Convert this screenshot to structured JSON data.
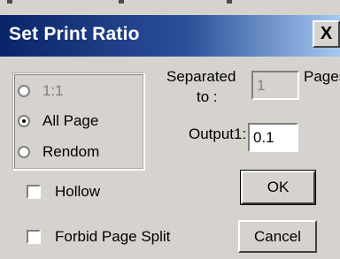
{
  "window": {
    "title": "Set Print Ratio",
    "close_glyph": "X"
  },
  "ratio_group": {
    "options": [
      {
        "label": "1:1",
        "checked": false,
        "enabled": false
      },
      {
        "label": "All Page",
        "checked": true,
        "enabled": true
      },
      {
        "label": "Rendom",
        "checked": false,
        "enabled": true
      }
    ]
  },
  "separated": {
    "label_line1": "Separated",
    "label_line2": "to :",
    "value": "1",
    "unit": "Pages"
  },
  "output": {
    "label": "Output1:",
    "value": "0.1"
  },
  "options": {
    "hollow": "Hollow",
    "forbid_page_split": "Forbid Page Split"
  },
  "buttons": {
    "ok": "OK",
    "cancel": "Cancel"
  }
}
